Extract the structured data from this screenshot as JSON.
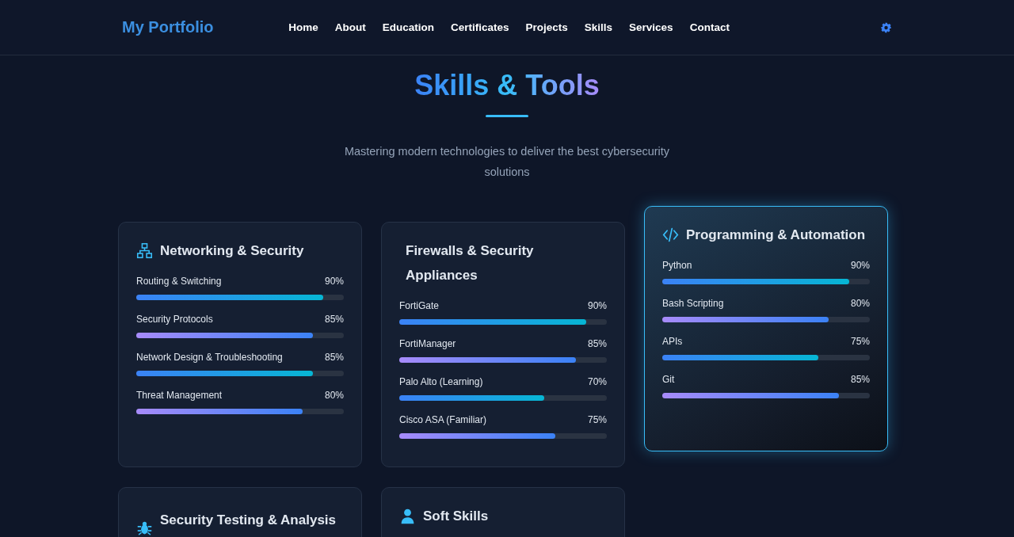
{
  "header": {
    "logo": "My Portfolio",
    "nav": [
      {
        "label": "Home"
      },
      {
        "label": "About"
      },
      {
        "label": "Education"
      },
      {
        "label": "Certificates"
      },
      {
        "label": "Projects"
      },
      {
        "label": "Skills"
      },
      {
        "label": "Services"
      },
      {
        "label": "Contact"
      }
    ]
  },
  "section": {
    "title": "Skills & Tools",
    "subtitle": "Mastering modern technologies to deliver the best cybersecurity solutions"
  },
  "cards": [
    {
      "title": "Networking & Security",
      "kind": "network",
      "highlighted": false,
      "skills": [
        {
          "name": "Routing & Switching",
          "reading": "90%",
          "level": 0.9,
          "kind": "primary"
        },
        {
          "name": "Security Protocols",
          "reading": "85%",
          "level": 0.85,
          "kind": "secondary"
        },
        {
          "name": "Network Design & Troubleshooting",
          "reading": "85%",
          "level": 0.85,
          "kind": "primary"
        },
        {
          "name": "Threat Management",
          "reading": "80%",
          "level": 0.8,
          "kind": "secondary"
        }
      ]
    },
    {
      "title": "Firewalls & Security Appliances",
      "kind": "plain",
      "highlighted": false,
      "skills": [
        {
          "name": "FortiGate",
          "reading": "90%",
          "level": 0.9,
          "kind": "primary"
        },
        {
          "name": "FortiManager",
          "reading": "85%",
          "level": 0.85,
          "kind": "secondary"
        },
        {
          "name": "Palo Alto (Learning)",
          "reading": "70%",
          "level": 0.7,
          "kind": "primary"
        },
        {
          "name": "Cisco ASA (Familiar)",
          "reading": "75%",
          "level": 0.75,
          "kind": "secondary"
        }
      ]
    },
    {
      "title": "Programming & Automation",
      "kind": "code",
      "highlighted": true,
      "skills": [
        {
          "name": "Python",
          "reading": "90%",
          "level": 0.9,
          "kind": "primary"
        },
        {
          "name": "Bash Scripting",
          "reading": "80%",
          "level": 0.8,
          "kind": "secondary"
        },
        {
          "name": "APIs",
          "reading": "75%",
          "level": 0.75,
          "kind": "primary"
        },
        {
          "name": "Git",
          "reading": "85%",
          "level": 0.85,
          "kind": "secondary"
        }
      ]
    },
    {
      "title": "Security Testing & Analysis",
      "kind": "bug",
      "highlighted": false
    },
    {
      "title": "Soft Skills",
      "kind": "person",
      "highlighted": false
    }
  ]
}
